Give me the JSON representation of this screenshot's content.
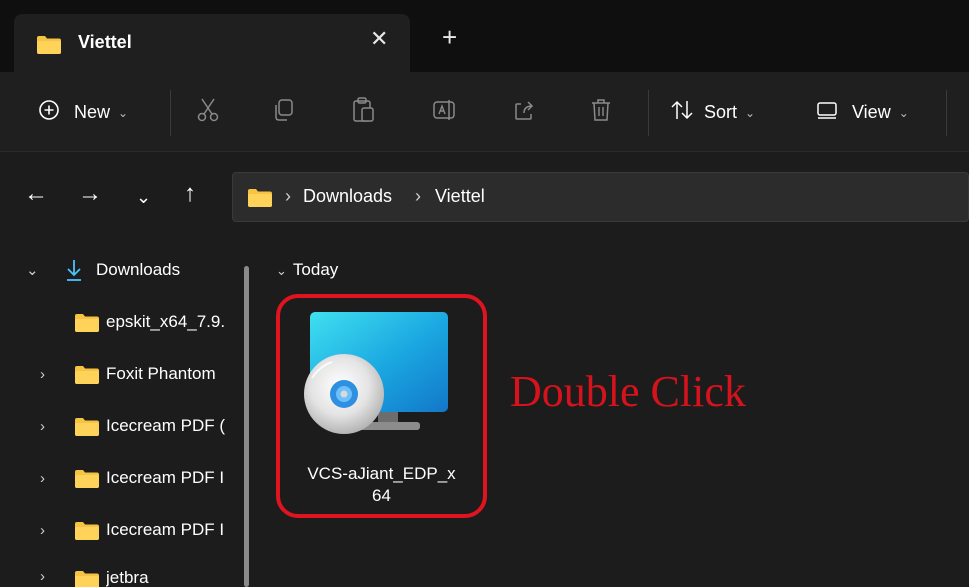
{
  "window": {
    "tab_title": "Viettel",
    "tab_close": "✕",
    "new_tab": "+"
  },
  "toolbar": {
    "new_label": "New",
    "sort_label": "Sort",
    "view_label": "View",
    "dropdown_glyph": "⌄"
  },
  "navigation": {
    "back": "←",
    "forward": "→",
    "recent": "⌄",
    "up": "↑",
    "breadcrumb": [
      "Downloads",
      "Viettel"
    ],
    "crumb_separator": "›"
  },
  "sidebar": {
    "items": [
      {
        "label": "Downloads",
        "expander": "⌄"
      },
      {
        "label": "epskit_x64_7.9.",
        "expander": ""
      },
      {
        "label": "Foxit Phantom",
        "expander": "›"
      },
      {
        "label": "Icecream PDF (",
        "expander": "›"
      },
      {
        "label": "Icecream PDF I",
        "expander": "›"
      },
      {
        "label": "Icecream PDF I",
        "expander": "›"
      },
      {
        "label": "jetbra",
        "expander": "›"
      }
    ]
  },
  "content": {
    "group_header": "Today",
    "group_chevron": "⌄",
    "file_name_line1": "VCS-aJiant_EDP_x",
    "file_name_line2": "64",
    "annotation": "Double Click"
  },
  "colors": {
    "folder_yellow": "#f6c343",
    "highlight_red": "#e0141e",
    "annotation_red": "#d4131c",
    "download_green": "#4cc2ff"
  },
  "icons": {
    "new": "plus-circle-icon",
    "cut": "scissors-icon",
    "copy": "copy-icon",
    "paste": "paste-icon",
    "rename": "rename-icon",
    "share": "share-icon",
    "delete": "trash-icon",
    "sort": "sort-arrows-icon",
    "view": "view-icon",
    "file": "installer-cd-icon"
  }
}
